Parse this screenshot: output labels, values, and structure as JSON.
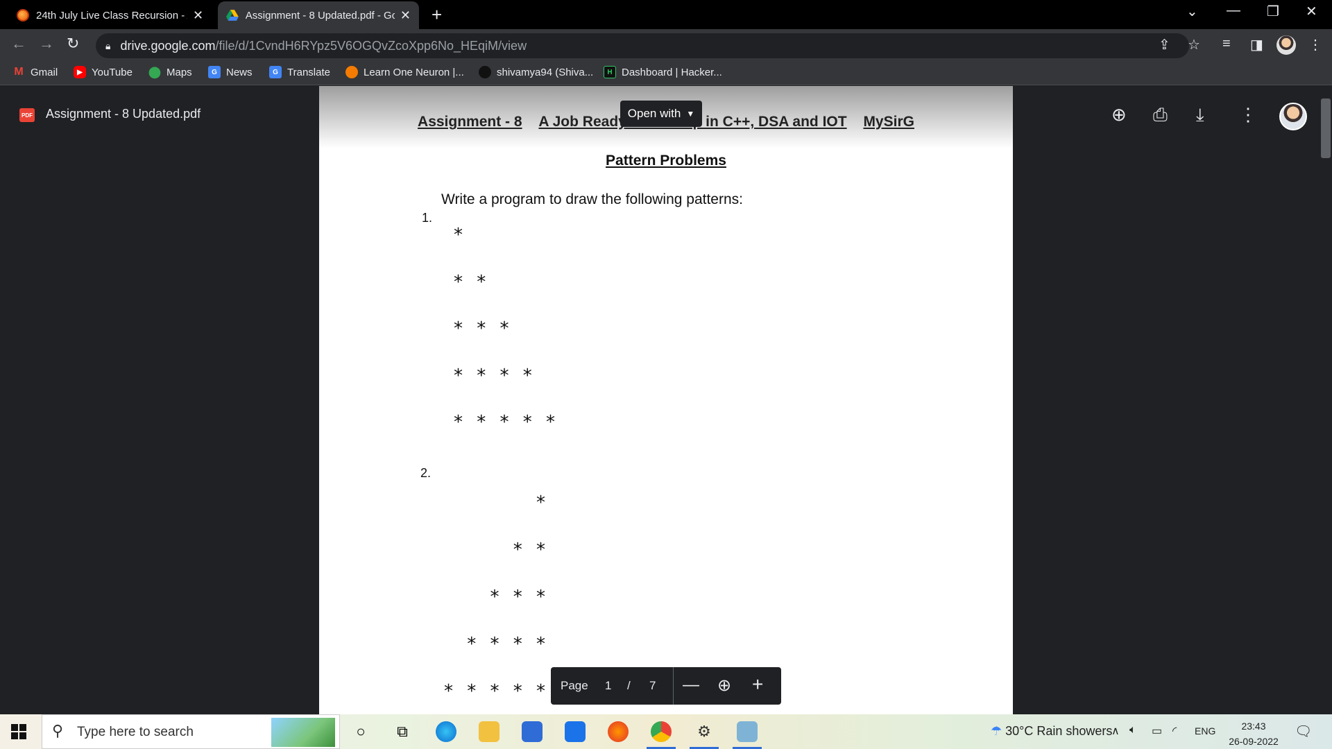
{
  "tabs": [
    {
      "title": "24th July Live Class Recursion - A",
      "active": false
    },
    {
      "title": "Assignment - 8 Updated.pdf - Go",
      "active": true
    }
  ],
  "toolbar": {
    "url_host": "drive.google.com",
    "url_path": "/file/d/1CvndH6RYpz5V6OGQvZcoXpp6No_HEqiM/view"
  },
  "bookmarks": [
    {
      "label": "Gmail",
      "icon": "gmail-icon"
    },
    {
      "label": "YouTube",
      "icon": "youtube-icon"
    },
    {
      "label": "Maps",
      "icon": "maps-icon"
    },
    {
      "label": "News",
      "icon": "news-icon"
    },
    {
      "label": "Translate",
      "icon": "translate-icon"
    },
    {
      "label": "Learn One Neuron |...",
      "icon": "ineuron-icon"
    },
    {
      "label": "shivamya94 (Shiva...",
      "icon": "github-icon"
    },
    {
      "label": "Dashboard | Hacker...",
      "icon": "hackerrank-icon"
    }
  ],
  "viewer": {
    "filename": "Assignment - 8 Updated.pdf",
    "badge": "PDF",
    "open_with": "Open with"
  },
  "document": {
    "heading": [
      "Assignment - 8",
      "A Job Ready Bootcamp in C++, DSA and IOT",
      "MySirG"
    ],
    "subtitle": "Pattern Problems",
    "instruction": "Write a program to draw the following patterns:",
    "q1_label": "1.",
    "q2_label": "2.",
    "pattern1": [
      "*",
      "* *",
      "* * *",
      "* * * *",
      "* * * * *"
    ],
    "pattern2": [
      "*",
      "* *",
      "* * *",
      "* * * *",
      "* * * * *"
    ]
  },
  "page_controls": {
    "label": "Page",
    "current": "1",
    "separator": "/",
    "total": "7"
  },
  "taskbar": {
    "search_placeholder": "Type here to search",
    "weather": "30°C  Rain showers",
    "language": "ENG",
    "time": "23:43",
    "date": "26-09-2022"
  },
  "colors": {
    "chrome_dark": "#202124",
    "tab_active": "#35363a",
    "pdf_badge": "#ea4335"
  }
}
